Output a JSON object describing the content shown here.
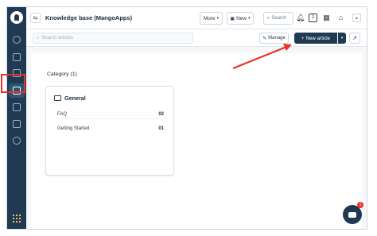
{
  "header": {
    "title": "Knowledge base (MangoApps)",
    "more_label": "More",
    "new_label": "New",
    "search_label": "Search",
    "notif_count": "2"
  },
  "toolbar": {
    "search_placeholder": "Search articles",
    "manage_label": "Manage",
    "new_article_label": "New article"
  },
  "main": {
    "category_heading": "Category (1)",
    "card": {
      "name": "General",
      "rows": [
        {
          "label": "FAQ",
          "count": "02"
        },
        {
          "label": "Getting Started",
          "count": "01"
        }
      ]
    }
  },
  "chat": {
    "badge": "1"
  },
  "colors": {
    "sidebar": "#1f3a52",
    "annotation": "#e8322a",
    "primary": "#1f3a52"
  }
}
